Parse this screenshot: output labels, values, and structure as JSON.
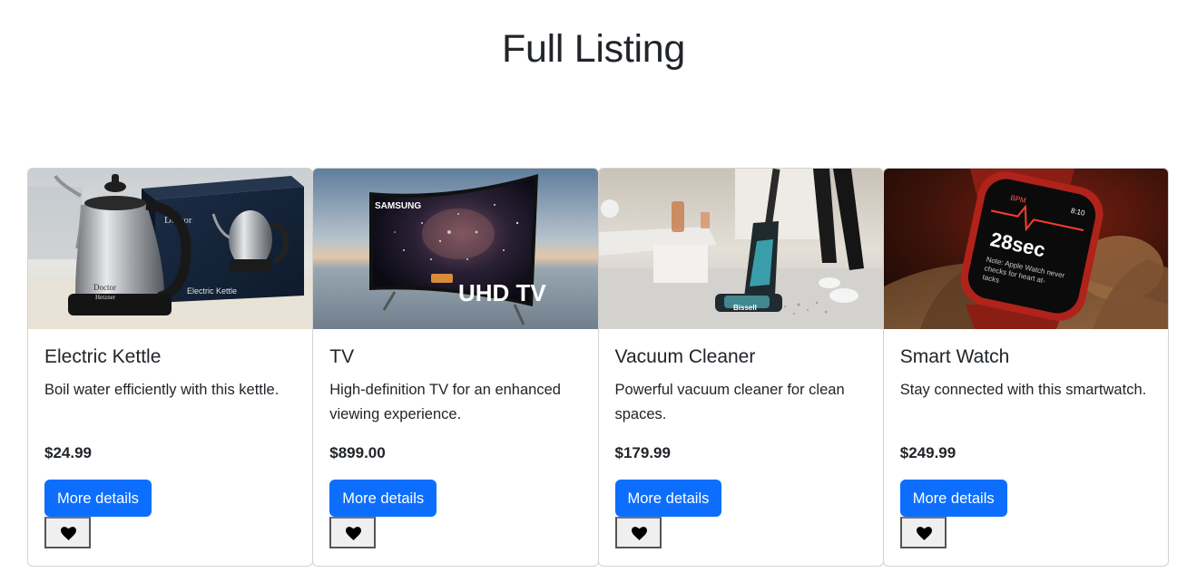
{
  "page": {
    "title": "Full Listing"
  },
  "products": [
    {
      "name": "Electric Kettle",
      "description": "Boil water efficiently with this kettle.",
      "price": "$24.99",
      "details_label": "More details",
      "favorite_icon": "heart-icon",
      "image": {
        "subject": "stainless gooseneck kettle with box",
        "brand_text": "Doctor Hetzner",
        "box_text": "Electric Kettle"
      }
    },
    {
      "name": "TV",
      "description": "High-definition TV for an enhanced viewing experience.",
      "price": "$899.00",
      "details_label": "More details",
      "favorite_icon": "heart-icon",
      "image": {
        "subject": "curved television on beach",
        "brand_text": "SAMSUNG",
        "screen_text": "UHD TV"
      }
    },
    {
      "name": "Vacuum Cleaner",
      "description": "Powerful vacuum cleaner for clean spaces.",
      "price": "$179.99",
      "details_label": "More details",
      "favorite_icon": "heart-icon",
      "image": {
        "subject": "upright cordless vacuum in living room",
        "brand_text": "Bissell"
      }
    },
    {
      "name": "Smart Watch",
      "description": "Stay connected with this smartwatch.",
      "price": "$249.99",
      "details_label": "More details",
      "favorite_icon": "heart-icon",
      "image": {
        "subject": "smartwatch on wrist showing ECG",
        "screen_main": "28sec",
        "screen_ecg": "ECG",
        "screen_time": "8:10",
        "screen_bpm": "BPM",
        "screen_note": "Note: Apple Watch never checks for heart attacks"
      }
    }
  ],
  "colors": {
    "primary": "#0d6efd",
    "text": "#212529",
    "border": "#d9d9d9",
    "fav_button_bg": "#efefef"
  }
}
